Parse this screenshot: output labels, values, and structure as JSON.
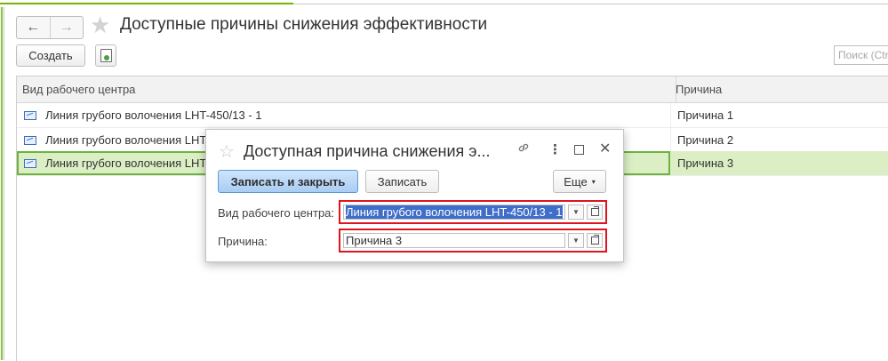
{
  "window": {
    "title": "Доступные причины снижения эффективности",
    "nav_back": "←",
    "nav_forward": "→",
    "star": "★"
  },
  "toolbar": {
    "create_label": "Создать",
    "search_placeholder": "Поиск (Ctrl+F)"
  },
  "table": {
    "columns": [
      "Вид рабочего центра",
      "Причина"
    ],
    "rows": [
      {
        "work_center": "Линия грубого волочения LHT-450/13 - 1",
        "reason": "Причина 1"
      },
      {
        "work_center": "Линия грубого волочения LHT",
        "reason": "Причина 2"
      },
      {
        "work_center": "Линия грубого волочения LHT",
        "reason": "Причина 3",
        "selected": true
      }
    ]
  },
  "dialog": {
    "title": "Доступная причина снижения э...",
    "star": "☆",
    "link_icon": "link-icon",
    "more_icon": "⋮",
    "close_icon": "✕",
    "save_close_label": "Записать и закрыть",
    "save_label": "Записать",
    "more_label": "Еще",
    "fields": {
      "work_center_label": "Вид рабочего центра:",
      "work_center_value": "Линия грубого волочения LHT-450/13 - 1",
      "reason_label": "Причина:",
      "reason_value": "Причина 3"
    }
  },
  "colors": {
    "accent_green": "#6db33f",
    "selected_row": "#dcefc4",
    "highlight_box": "#e0141e",
    "primary_button": "#a9cdf3",
    "selection_text_bg": "#3e6ec9"
  }
}
